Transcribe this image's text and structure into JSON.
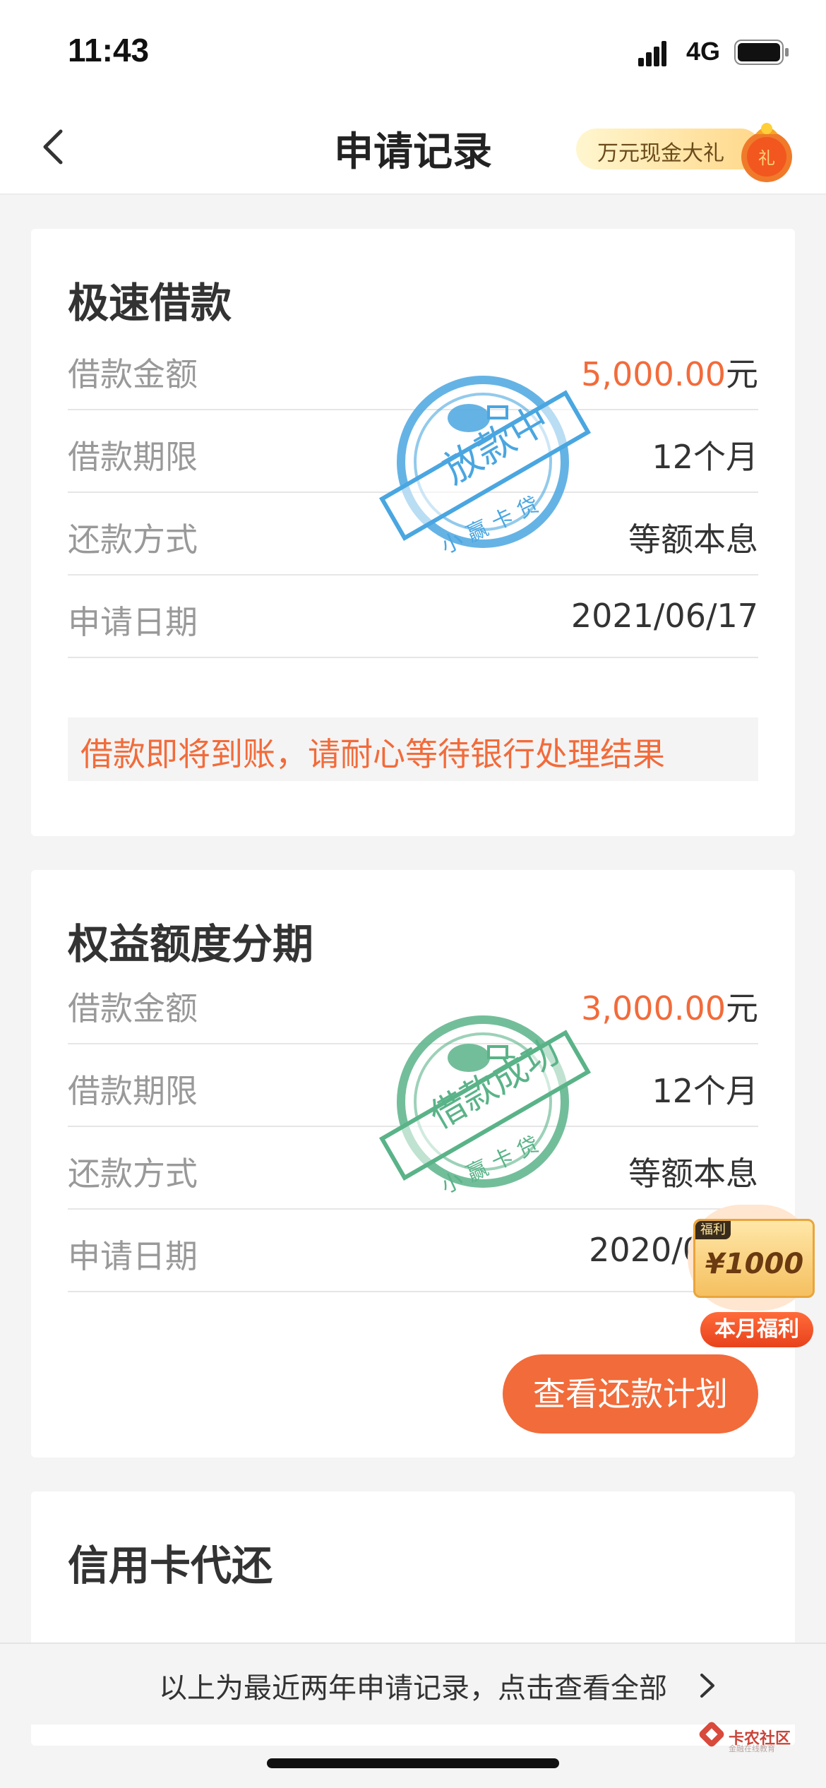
{
  "status_bar": {
    "time": "11:43",
    "network": "4G"
  },
  "nav": {
    "title": "申请记录",
    "promo_text": "万元现金大礼"
  },
  "cards": [
    {
      "title": "极速借款",
      "stamp": "放款中",
      "rows": [
        {
          "label": "借款金额",
          "amount": "5,000.00",
          "unit": "元"
        },
        {
          "label": "借款期限",
          "value": "12个月"
        },
        {
          "label": "还款方式",
          "value": "等额本息"
        },
        {
          "label": "申请日期",
          "value": "2021/06/17"
        }
      ],
      "notice": "借款即将到账，请耐心等待银行处理结果"
    },
    {
      "title": "权益额度分期",
      "stamp": "借款成功",
      "rows": [
        {
          "label": "借款金额",
          "amount": "3,000.00",
          "unit": "元"
        },
        {
          "label": "借款期限",
          "value": "12个月"
        },
        {
          "label": "还款方式",
          "value": "等额本息"
        },
        {
          "label": "申请日期",
          "value": "2020/0"
        }
      ],
      "button": "查看还款计划"
    },
    {
      "title": "信用卡代还"
    }
  ],
  "reward": {
    "tag": "福利",
    "amount": "¥1000",
    "label": "本月福利"
  },
  "footer": {
    "text": "以上为最近两年申请记录，点击查看全部"
  },
  "watermark": {
    "text": "卡农社区",
    "subtext": "金融在线教育"
  },
  "colors": {
    "accent": "#f26b3a",
    "stamp_blue": "#4aa6e0",
    "stamp_green": "#5ab388"
  },
  "icons": [
    "signal-icon",
    "battery-icon",
    "back-icon",
    "gift-bag-icon",
    "chevron-right-icon"
  ]
}
